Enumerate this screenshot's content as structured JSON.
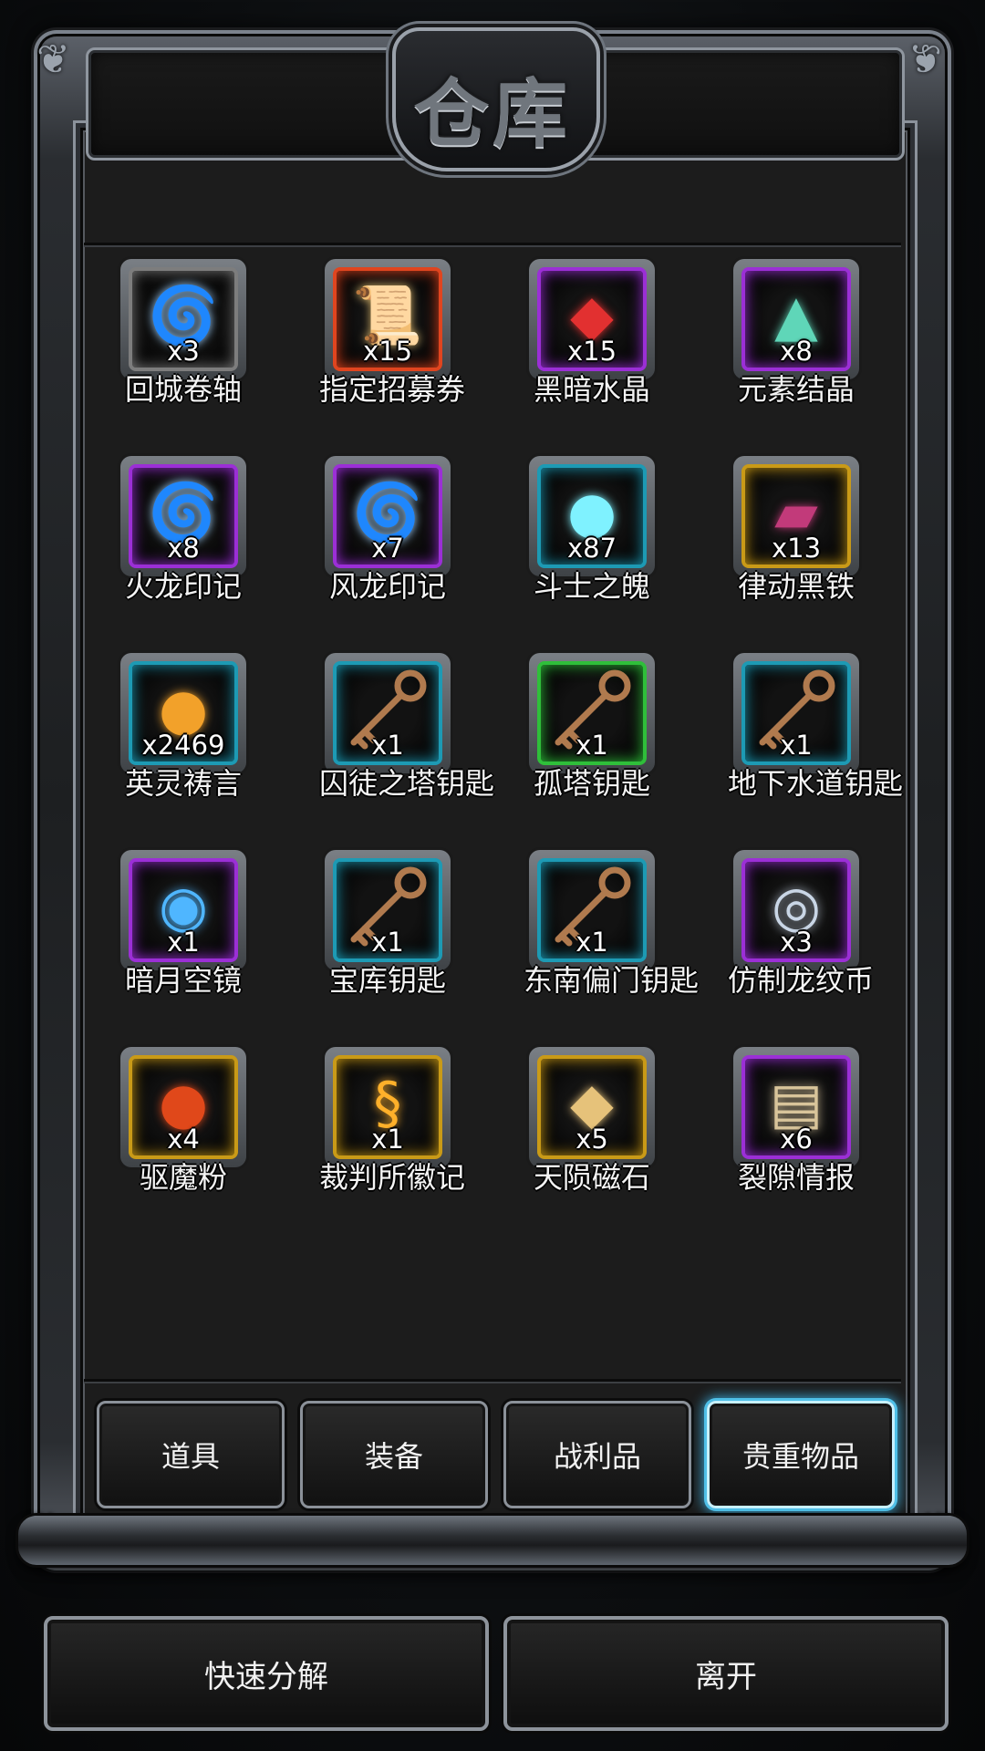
{
  "title": "仓库",
  "items": [
    {
      "name": "回城卷轴",
      "qty": "x3",
      "rarity": "#7d7d7d",
      "icon": "swirl-stone-icon",
      "glyph": "🌀",
      "icon_color": "#9fd2ff"
    },
    {
      "name": "指定招募券",
      "qty": "x15",
      "rarity": "#e0451f",
      "icon": "scroll-icon",
      "glyph": "📜",
      "icon_color": "#d8b46a"
    },
    {
      "name": "黑暗水晶",
      "qty": "x15",
      "rarity": "#9b2fd6",
      "icon": "red-crystal-icon",
      "glyph": "◆",
      "icon_color": "#e23030"
    },
    {
      "name": "元素结晶",
      "qty": "x8",
      "rarity": "#9b2fd6",
      "icon": "crystal-dust-icon",
      "glyph": "▲",
      "icon_color": "#5fd6b8"
    },
    {
      "name": "火龙印记",
      "qty": "x8",
      "rarity": "#9b2fd6",
      "icon": "swirl-stone-icon",
      "glyph": "🌀",
      "icon_color": "#9fd2ff"
    },
    {
      "name": "风龙印记",
      "qty": "x7",
      "rarity": "#9b2fd6",
      "icon": "swirl-stone-icon",
      "glyph": "🌀",
      "icon_color": "#9fd2ff"
    },
    {
      "name": "斗士之魄",
      "qty": "x87",
      "rarity": "#1d9ab4",
      "icon": "soul-flame-icon",
      "glyph": "●",
      "icon_color": "#7ff2ff"
    },
    {
      "name": "律动黑铁",
      "qty": "x13",
      "rarity": "#c99a17",
      "icon": "iron-ingot-icon",
      "glyph": "▰",
      "icon_color": "#c23a7a"
    },
    {
      "name": "英灵祷言",
      "qty": "x2469",
      "rarity": "#1d9ab4",
      "icon": "golden-orb-icon",
      "glyph": "●",
      "icon_color": "#f2a12a"
    },
    {
      "name": "囚徒之塔钥匙",
      "qty": "x1",
      "rarity": "#1d9ab4",
      "icon": "key-icon",
      "glyph": "key",
      "icon_color": "#b07a4e"
    },
    {
      "name": "孤塔钥匙",
      "qty": "x1",
      "rarity": "#2fbf3a",
      "icon": "key-icon",
      "glyph": "key",
      "icon_color": "#b07a4e"
    },
    {
      "name": "地下水道钥匙",
      "qty": "x1",
      "rarity": "#1d9ab4",
      "icon": "key-icon",
      "glyph": "key",
      "icon_color": "#b07a4e"
    },
    {
      "name": "暗月空镜",
      "qty": "x1",
      "rarity": "#9b2fd6",
      "icon": "mirror-icon",
      "glyph": "◉",
      "icon_color": "#4fb6ff"
    },
    {
      "name": "宝库钥匙",
      "qty": "x1",
      "rarity": "#1d9ab4",
      "icon": "key-icon",
      "glyph": "key",
      "icon_color": "#b07a4e"
    },
    {
      "name": "东南偏门钥匙",
      "qty": "x1",
      "rarity": "#1d9ab4",
      "icon": "key-icon",
      "glyph": "key",
      "icon_color": "#b07a4e"
    },
    {
      "name": "仿制龙纹币",
      "qty": "x3",
      "rarity": "#9b2fd6",
      "icon": "silver-coin-icon",
      "glyph": "◎",
      "icon_color": "#c9d6e6"
    },
    {
      "name": "驱魔粉",
      "qty": "x4",
      "rarity": "#c99a17",
      "icon": "fire-powder-icon",
      "glyph": "●",
      "icon_color": "#e0481a"
    },
    {
      "name": "裁判所徽记",
      "qty": "x1",
      "rarity": "#c99a17",
      "icon": "seal-icon",
      "glyph": "§",
      "icon_color": "#ffb02a"
    },
    {
      "name": "天陨磁石",
      "qty": "x5",
      "rarity": "#c99a17",
      "icon": "meteor-stone-icon",
      "glyph": "◆",
      "icon_color": "#e6c27a"
    },
    {
      "name": "裂隙情报",
      "qty": "x6",
      "rarity": "#9b2fd6",
      "icon": "parchment-icon",
      "glyph": "▤",
      "icon_color": "#d8c49a"
    }
  ],
  "tabs": [
    {
      "label": "道具",
      "active": false
    },
    {
      "label": "装备",
      "active": false
    },
    {
      "label": "战利品",
      "active": false
    },
    {
      "label": "贵重物品",
      "active": true
    }
  ],
  "buttons": {
    "disassemble": "快速分解",
    "leave": "离开"
  }
}
